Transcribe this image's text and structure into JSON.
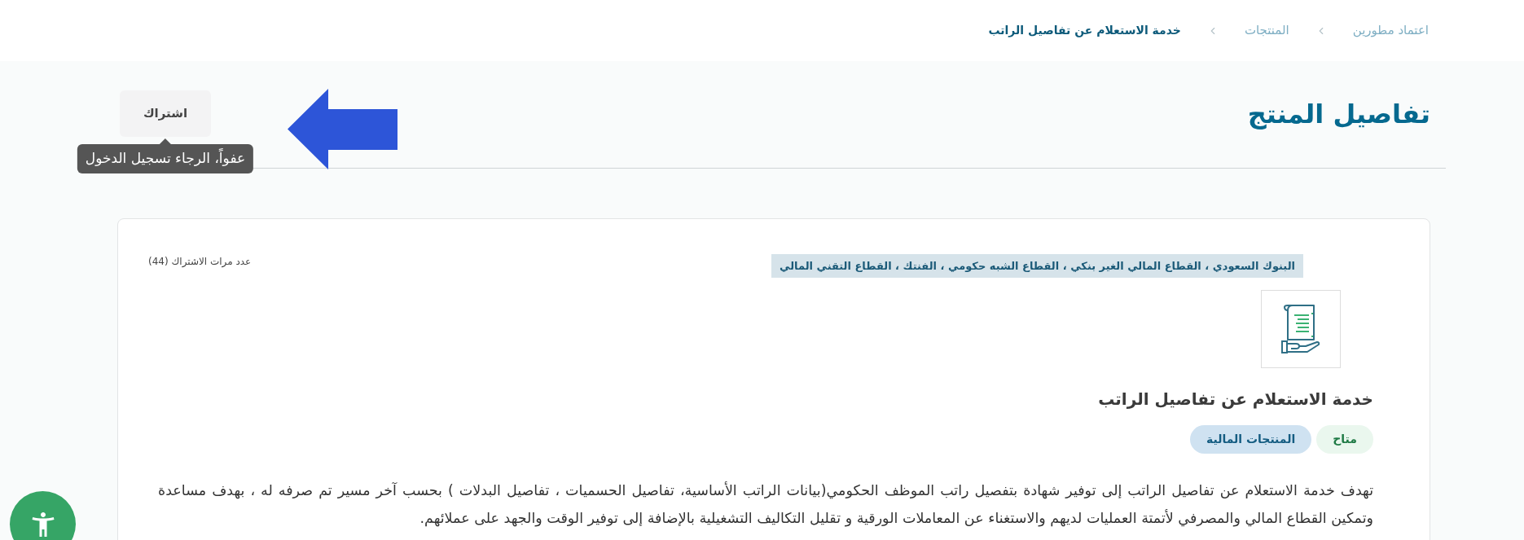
{
  "breadcrumb": [
    {
      "label": "اعتماد مطورين",
      "selected": false
    },
    {
      "label": "المنتجات",
      "selected": false
    },
    {
      "label": "خدمة الاستعلام عن تفاصيل الراتب",
      "selected": true
    }
  ],
  "page_title": "تفاصيل المنتج",
  "subscribe_button": {
    "label": "اشتراك"
  },
  "tooltip": {
    "text": "عفواً، الرجاء تسجيل الدخول"
  },
  "product": {
    "sectors": "البنوك السعودي ، القطاع المالي الغير بنكي ، القطاع الشبه حكومي ، الفنتك ، القطاع التقني المالي",
    "subscription_count": "عدد مرات الاشتراك (44)",
    "name": "خدمة الاستعلام عن تفاصيل الراتب",
    "badges": [
      {
        "label": "متاح",
        "kind": "status"
      },
      {
        "label": "المنتجات المالية",
        "kind": "category"
      }
    ],
    "description": "تهدف خدمة الاستعلام عن تفاصيل الراتب إلى توفير شهادة بتفصيل راتب الموظف الحكومي(بيانات الراتب الأساسية، تفاصيل الحسميات ، تفاصيل البدلات ) بحسب آخر مسير تم صرفه له ، بهدف مساعدة وتمكين القطاع المالي والمصرفي لأتمتة العمليات لديهم والاستغناء عن المعاملات الورقية و تقليل التكاليف التشغيلية بالإضافة إلى توفير الوقت والجهد على عملائهم."
  }
}
